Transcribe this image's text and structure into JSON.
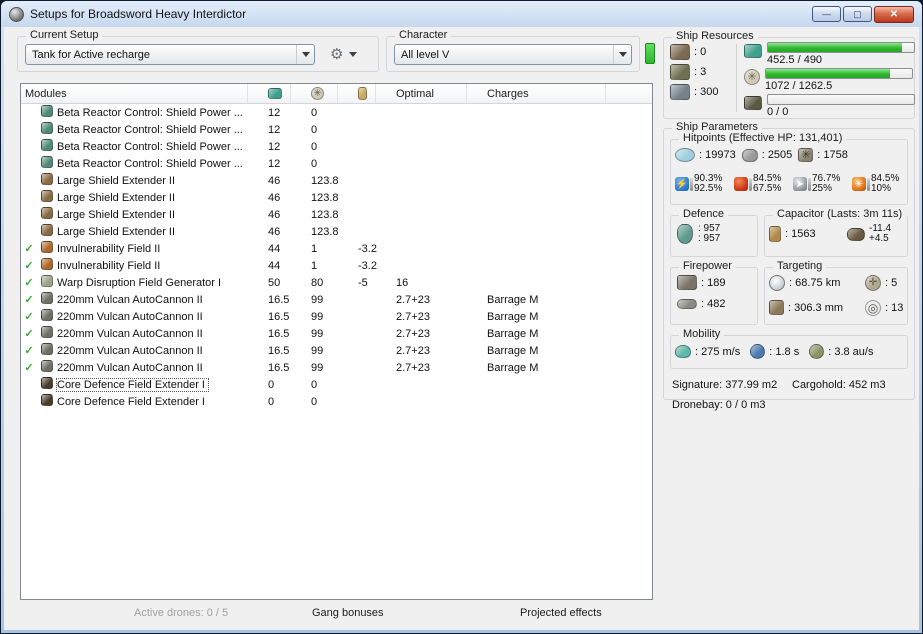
{
  "icons": {
    "minimize": "—",
    "maximize": "▢",
    "close": "✕",
    "active_check": "✓",
    "em_lightning": "⚡",
    "kinetic_arrow": "➤",
    "explosive_burst": "✳",
    "powergrid_star": "✳",
    "compass_cross": "✛",
    "sensor_rings": "◎",
    "gear": "⚙"
  },
  "window": {
    "title": "Setups for Broadsword Heavy Interdictor"
  },
  "current_setup": {
    "label": "Current Setup",
    "value": "Tank for Active recharge"
  },
  "character": {
    "label": "Character",
    "value": "All level V"
  },
  "modules": {
    "header": {
      "name": "Modules",
      "optimal": "Optimal",
      "charges": "Charges"
    },
    "rows": [
      {
        "active": false,
        "focused": false,
        "icon": "shield-power-relay",
        "color": "#4e8a74",
        "name": "Beta Reactor Control: Shield Power ...",
        "cpu": "12",
        "pg": "0",
        "cap": "",
        "optimal": "",
        "charges": ""
      },
      {
        "active": false,
        "focused": false,
        "icon": "shield-power-relay",
        "color": "#4e8a74",
        "name": "Beta Reactor Control: Shield Power ...",
        "cpu": "12",
        "pg": "0",
        "cap": "",
        "optimal": "",
        "charges": ""
      },
      {
        "active": false,
        "focused": false,
        "icon": "shield-power-relay",
        "color": "#4e8a74",
        "name": "Beta Reactor Control: Shield Power ...",
        "cpu": "12",
        "pg": "0",
        "cap": "",
        "optimal": "",
        "charges": ""
      },
      {
        "active": false,
        "focused": false,
        "icon": "shield-power-relay",
        "color": "#4e8a74",
        "name": "Beta Reactor Control: Shield Power ...",
        "cpu": "12",
        "pg": "0",
        "cap": "",
        "optimal": "",
        "charges": ""
      },
      {
        "active": false,
        "focused": false,
        "icon": "shield-extender",
        "color": "#8a6a42",
        "name": "Large Shield Extender II",
        "cpu": "46",
        "pg": "123.8",
        "cap": "",
        "optimal": "",
        "charges": ""
      },
      {
        "active": false,
        "focused": false,
        "icon": "shield-extender",
        "color": "#8a6a42",
        "name": "Large Shield Extender II",
        "cpu": "46",
        "pg": "123.8",
        "cap": "",
        "optimal": "",
        "charges": ""
      },
      {
        "active": false,
        "focused": false,
        "icon": "shield-extender",
        "color": "#8a6a42",
        "name": "Large Shield Extender II",
        "cpu": "46",
        "pg": "123.8",
        "cap": "",
        "optimal": "",
        "charges": ""
      },
      {
        "active": false,
        "focused": false,
        "icon": "shield-extender",
        "color": "#8a6a42",
        "name": "Large Shield Extender II",
        "cpu": "46",
        "pg": "123.8",
        "cap": "",
        "optimal": "",
        "charges": ""
      },
      {
        "active": true,
        "focused": false,
        "icon": "invulnerability-field",
        "color": "#b06828",
        "name": "Invulnerability Field II",
        "cpu": "44",
        "pg": "1",
        "cap": "-3.2",
        "optimal": "",
        "charges": ""
      },
      {
        "active": true,
        "focused": false,
        "icon": "invulnerability-field",
        "color": "#b06828",
        "name": "Invulnerability Field II",
        "cpu": "44",
        "pg": "1",
        "cap": "-3.2",
        "optimal": "",
        "charges": ""
      },
      {
        "active": true,
        "focused": false,
        "icon": "warp-disruption-field-generator",
        "color": "#9aa488",
        "name": "Warp Disruption Field Generator I",
        "cpu": "50",
        "pg": "80",
        "cap": "-5",
        "optimal": "16",
        "charges": ""
      },
      {
        "active": true,
        "focused": false,
        "icon": "autocannon",
        "color": "#6e6e64",
        "name": "220mm Vulcan AutoCannon II",
        "cpu": "16.5",
        "pg": "99",
        "cap": "",
        "optimal": "2.7+23",
        "charges": "Barrage M"
      },
      {
        "active": true,
        "focused": false,
        "icon": "autocannon",
        "color": "#6e6e64",
        "name": "220mm Vulcan AutoCannon II",
        "cpu": "16.5",
        "pg": "99",
        "cap": "",
        "optimal": "2.7+23",
        "charges": "Barrage M"
      },
      {
        "active": true,
        "focused": false,
        "icon": "autocannon",
        "color": "#6e6e64",
        "name": "220mm Vulcan AutoCannon II",
        "cpu": "16.5",
        "pg": "99",
        "cap": "",
        "optimal": "2.7+23",
        "charges": "Barrage M"
      },
      {
        "active": true,
        "focused": false,
        "icon": "autocannon",
        "color": "#6e6e64",
        "name": "220mm Vulcan AutoCannon II",
        "cpu": "16.5",
        "pg": "99",
        "cap": "",
        "optimal": "2.7+23",
        "charges": "Barrage M"
      },
      {
        "active": true,
        "focused": false,
        "icon": "autocannon",
        "color": "#6e6e64",
        "name": "220mm Vulcan AutoCannon II",
        "cpu": "16.5",
        "pg": "99",
        "cap": "",
        "optimal": "2.7+23",
        "charges": "Barrage M"
      },
      {
        "active": false,
        "focused": true,
        "icon": "rig-core-defence",
        "color": "#4a3a2a",
        "name": "Core Defence Field Extender I",
        "cpu": "0",
        "pg": "0",
        "cap": "",
        "optimal": "",
        "charges": ""
      },
      {
        "active": false,
        "focused": false,
        "icon": "rig-core-defence",
        "color": "#4a3a2a",
        "name": "Core Defence Field Extender I",
        "cpu": "0",
        "pg": "0",
        "cap": "",
        "optimal": "",
        "charges": ""
      }
    ]
  },
  "footer": {
    "active_drones": "Active drones: 0 / 5",
    "gang_bonuses": "Gang bonuses",
    "projected_effects": "Projected effects"
  },
  "ship_resources": {
    "label": "Ship Resources",
    "turrets": ": 0",
    "launchers": ": 3",
    "calibration": ": 300",
    "bars": [
      {
        "name": "cpu",
        "text": "452.5 / 490",
        "pct": 92
      },
      {
        "name": "powergrid",
        "text": "1072 / 1262.5",
        "pct": 85
      },
      {
        "name": "drones",
        "text": "0 / 0",
        "pct": 0
      }
    ]
  },
  "ship_parameters": {
    "label": "Ship Parameters",
    "hitpoints": {
      "label": "Hitpoints (Effective HP: 131,401)",
      "shield": ": 19973",
      "armor": ": 2505",
      "hull": ": 1758",
      "resists": [
        {
          "name": "em",
          "color": "#2e7fd4",
          "top": "90.3%",
          "bottom": "92.5%"
        },
        {
          "name": "thermal",
          "color": "#d43a1a",
          "top": "84.5%",
          "bottom": "67.5%"
        },
        {
          "name": "kinetic",
          "color": "#9aa0a8",
          "top": "76.7%",
          "bottom": "25%"
        },
        {
          "name": "explosive",
          "color": "#e07820",
          "top": "84.5%",
          "bottom": "10%"
        }
      ]
    },
    "defence": {
      "label": "Defence",
      "value1": ": 957",
      "value2": ": 957"
    },
    "capacitor": {
      "label": "Capacitor (Lasts: 3m 11s)",
      "amount": ": 1563",
      "drain": "-11.4",
      "recharge": "+4.5"
    },
    "firepower": {
      "label": "Firepower",
      "volley": ": 189",
      "dps": ": 482"
    },
    "targeting": {
      "label": "Targeting",
      "range": ": 68.75 km",
      "max_targets": ": 5",
      "scan_res": ": 306.3 mm",
      "sensor_strength": ": 13"
    },
    "mobility": {
      "label": "Mobility",
      "speed": ": 275 m/s",
      "align": ": 1.8 s",
      "warp": ": 3.8 au/s"
    },
    "signature": "Signature: 377.99 m2",
    "cargohold": "Cargohold: 452 m3",
    "dronebay": "Dronebay: 0 / 0 m3"
  }
}
